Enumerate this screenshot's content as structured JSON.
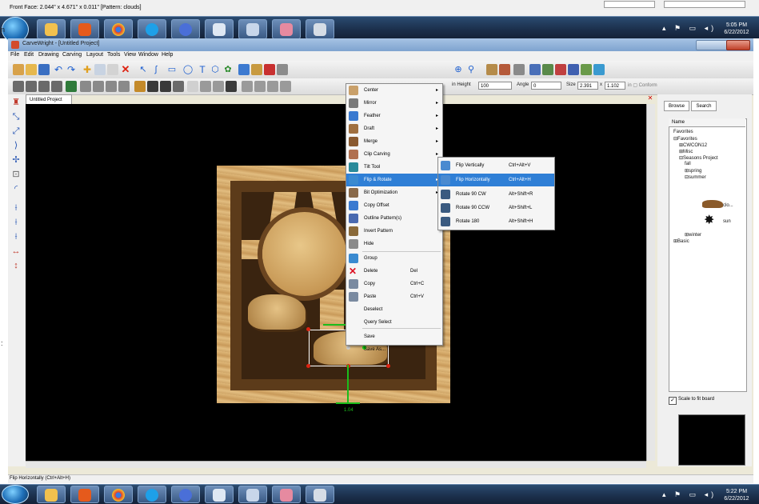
{
  "top_status": "Front Face: 2.044\" x 4.671\" x 0.011\"  [Pattern: clouds]",
  "app": {
    "title": "CarveWright - [Untitled Project]",
    "document_tab": "Untitled Project"
  },
  "menubar": [
    "File",
    "Edit",
    "Drawing",
    "Carving",
    "Layout",
    "Tools",
    "View",
    "Window",
    "Help"
  ],
  "toolbar_fields": {
    "height_label": "in  Height",
    "height_value": "100",
    "angle_label": "Angle",
    "angle_value": "0",
    "size_label": "Size",
    "size_w": "2.391",
    "size_x": "x",
    "size_h": "1.102",
    "conform_label": "in  ▢  Conform"
  },
  "context_menu": [
    {
      "label": "Center",
      "submenu": true,
      "icon": "center-icon"
    },
    {
      "label": "Mirror",
      "submenu": true,
      "icon": "mirror-icon"
    },
    {
      "label": "Feather",
      "submenu": true,
      "icon": "feather-icon"
    },
    {
      "label": "Draft",
      "submenu": true,
      "icon": "draft-icon"
    },
    {
      "label": "Merge",
      "submenu": true,
      "icon": "merge-icon"
    },
    {
      "label": "Clip Carving",
      "submenu": true,
      "icon": "clip-carving-icon"
    },
    {
      "label": "Tilt Tool",
      "submenu": false,
      "icon": "tilt-tool-icon"
    },
    {
      "label": "Flip & Rotate",
      "submenu": true,
      "icon": "flip-rotate-icon",
      "highlighted": true
    },
    {
      "label": "Bit Optimization",
      "submenu": true,
      "icon": "bit-optimization-icon"
    },
    {
      "label": "Copy Offset",
      "submenu": false,
      "icon": "copy-offset-icon"
    },
    {
      "label": "Outline Pattern(s)",
      "submenu": false,
      "icon": "outline-pattern-icon"
    },
    {
      "label": "Invert Pattern",
      "submenu": false,
      "icon": "invert-pattern-icon"
    },
    {
      "label": "Hide",
      "submenu": false,
      "icon": "hide-icon"
    },
    {
      "label": "Group",
      "submenu": false,
      "icon": "group-icon"
    },
    {
      "label": "Delete",
      "shortcut": "Del",
      "icon": "delete-icon"
    },
    {
      "label": "Copy",
      "shortcut": "Ctrl+C",
      "icon": "copy-icon"
    },
    {
      "label": "Paste",
      "shortcut": "Ctrl+V",
      "icon": "paste-icon"
    },
    {
      "label": "Deselect",
      "icon": ""
    },
    {
      "label": "Query Select",
      "icon": ""
    },
    {
      "label": "Save",
      "icon": ""
    },
    {
      "label": "Save As...",
      "icon": ""
    }
  ],
  "submenu": [
    {
      "label": "Flip Vertically",
      "shortcut": "Ctrl+Alt+V",
      "icon": "flip-vertical-icon"
    },
    {
      "label": "Flip Horizontally",
      "shortcut": "Ctrl+Alt+H",
      "icon": "flip-horizontal-icon",
      "highlighted": true
    },
    {
      "label": "Rotate 90 CW",
      "shortcut": "Alt+Shift+R",
      "icon": "rotate-cw-icon"
    },
    {
      "label": "Rotate 90 CCW",
      "shortcut": "Alt+Shift+L",
      "icon": "rotate-ccw-icon"
    },
    {
      "label": "Rotate 180",
      "shortcut": "Alt+Shift+H",
      "icon": "rotate-180-icon"
    }
  ],
  "right_panel": {
    "tabs": [
      "Browse",
      "Search"
    ],
    "tree_header": "Name",
    "tree": [
      {
        "label": "Favorites",
        "depth": 0
      },
      {
        "label": "Favorites",
        "depth": 0,
        "prefix": "⊟"
      },
      {
        "label": "CWCON12",
        "depth": 1,
        "prefix": "⊞"
      },
      {
        "label": "Misc",
        "depth": 1,
        "prefix": "⊞"
      },
      {
        "label": "Seasons Project",
        "depth": 1,
        "prefix": "⊟"
      },
      {
        "label": "fall",
        "depth": 2
      },
      {
        "label": "spring",
        "depth": 2,
        "prefix": "⊞"
      },
      {
        "label": "summer",
        "depth": 2,
        "prefix": "⊟"
      },
      {
        "label": "clo...",
        "depth": 4
      },
      {
        "label": "sun",
        "depth": 4
      },
      {
        "label": "winter",
        "depth": 2,
        "prefix": "⊞"
      },
      {
        "label": "Basic",
        "depth": 0,
        "prefix": "⊞"
      }
    ],
    "scale_label": "Scale to fit board",
    "scale_checked": true
  },
  "canvas": {
    "dimension_label": "1.04"
  },
  "status_bar": "Flip Horizontally (Ctrl+Alt+H)",
  "taskbars": {
    "top": {
      "time": "5:05 PM",
      "date": "6/22/2012"
    },
    "bottom": {
      "time": "5:22 PM",
      "date": "6/22/2012"
    }
  },
  "colors": {
    "menu_highlight": "#2f7fd6",
    "canvas_bg": "#000000",
    "guide_green": "#1bbd1b"
  }
}
